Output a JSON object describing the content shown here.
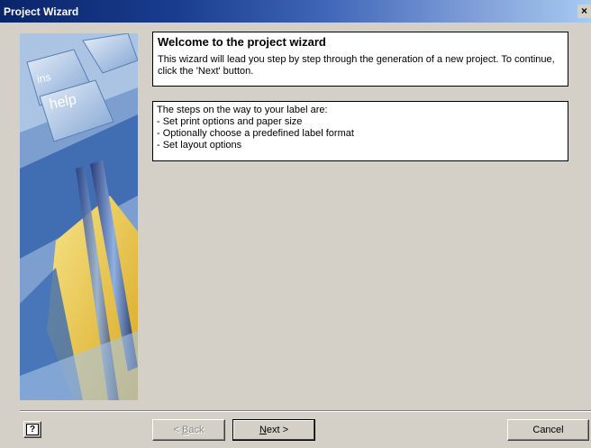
{
  "window": {
    "title": "Project Wizard",
    "close_glyph": "×"
  },
  "sidebar": {
    "keys": [
      "ins",
      "help"
    ]
  },
  "welcome": {
    "heading": "Welcome to the project wizard",
    "text": "This wizard will lead you step by step through the generation of a new project. To continue, click the 'Next' button."
  },
  "steps": {
    "intro": "The steps on the way to your label are:",
    "items": [
      "- Set print options and paper size",
      "- Optionally choose a predefined label format",
      "- Set layout options"
    ]
  },
  "buttons": {
    "help_glyph": "?",
    "back_prefix": "< ",
    "back_mnemonic": "B",
    "back_rest": "ack",
    "next_mnemonic": "N",
    "next_rest": "ext >",
    "cancel": "Cancel"
  },
  "colors": {
    "titlebar_start": "#0a246a",
    "titlebar_end": "#a6caf0",
    "dialog_face": "#d4d0c8",
    "disabled_text": "#8a8a8a"
  }
}
